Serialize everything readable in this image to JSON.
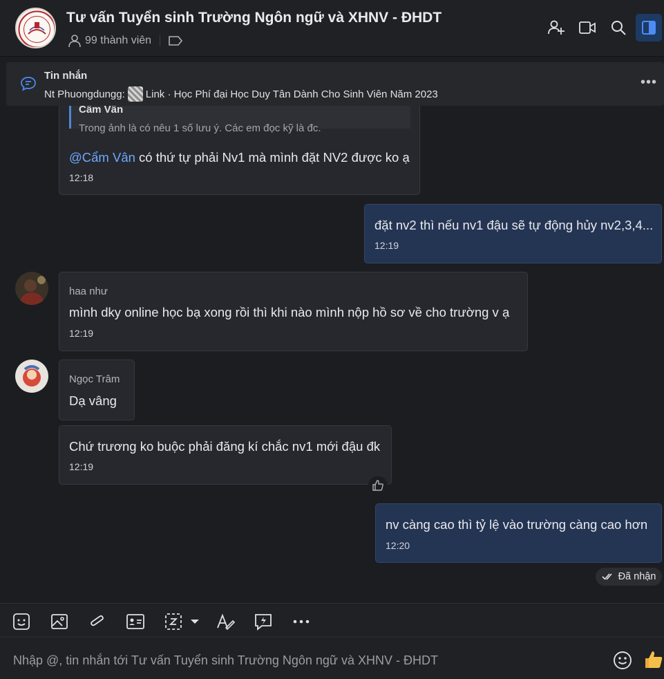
{
  "header": {
    "title": "Tư vấn Tuyển sinh Trường Ngôn ngữ và XHNV - ĐHDT",
    "members": "99 thành viên"
  },
  "pinned": {
    "title": "Tin nhắn",
    "sender": "Nt Phuongdungg:",
    "text": "Link · Học Phí đại Học Duy Tân Dành Cho Sinh Viên Năm 2023"
  },
  "messages": [
    {
      "quote_name": "Cẩm Vân",
      "quote_text": "Trong ảnh là có nêu 1 số lưu ý. Các em đọc kỹ là đc.",
      "mention": "@Cẩm Vân",
      "text": " có thứ tự  phải Nv1 mà mình đặt NV2 được ko ạ",
      "time": "12:18"
    },
    {
      "text": "đặt nv2 thì nếu nv1 đậu sẽ tự động hủy nv2,3,4...",
      "time": "12:19"
    },
    {
      "sender": "haa như",
      "text": "mình dky online học bạ xong rồi thì khi nào mình nộp hồ sơ về cho trường v ạ",
      "time": "12:19"
    },
    {
      "sender": "Ngọc Trâm",
      "text": "Dạ vâng"
    },
    {
      "text": "Chứ trương ko buộc phải đăng kí chắc nv1 mới đậu đk",
      "time": "12:19"
    },
    {
      "text": "nv càng cao thì tỷ lệ vào trường càng cao hơn",
      "time": "12:20"
    }
  ],
  "status": {
    "received": "Đã nhận"
  },
  "composer": {
    "placeholder": "Nhập @, tin nhắn tới Tư vấn Tuyển sinh Trường Ngôn ngữ và XHNV - ĐHDT"
  },
  "colors": {
    "background": "#1b1d21",
    "own_bubble": "#243453",
    "other_bubble": "#26282d",
    "mention": "#6ea8fe",
    "accent": "#1d3a63"
  },
  "icons": [
    "add-member-icon",
    "video-call-icon",
    "search-icon",
    "sidebar-toggle-icon",
    "pinned-message-icon",
    "more-icon",
    "emoji-sticker-icon",
    "image-icon",
    "attachment-icon",
    "contact-card-icon",
    "screenshot-icon",
    "format-text-icon",
    "quick-message-icon",
    "emoji-icon",
    "thumbs-up-icon"
  ]
}
